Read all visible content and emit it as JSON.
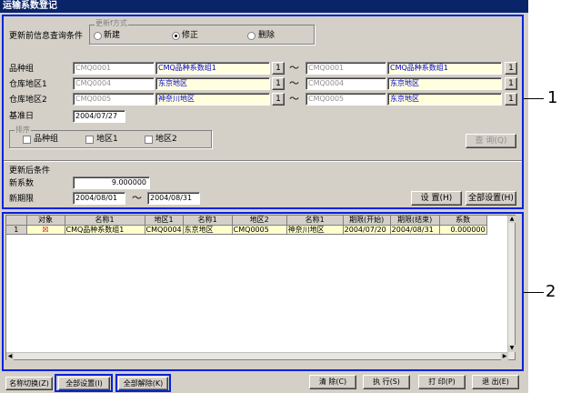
{
  "window": {
    "title": "运输系数登记"
  },
  "search": {
    "label": "更新前信息查询条件",
    "update_method": {
      "caption": "更新f方式",
      "options": [
        {
          "label": "新建",
          "selected": false
        },
        {
          "label": "修正",
          "selected": true
        },
        {
          "label": "删除",
          "selected": false
        }
      ]
    },
    "tilde": "～",
    "rows": [
      {
        "label": "品种组",
        "from_code": "CMQ0001",
        "from_name": "CMQ品种系数组1",
        "to_code": "CMQ0001",
        "to_name": "CMQ品种系数组1",
        "btn": "1"
      },
      {
        "label": "仓库地区1",
        "from_code": "CMQ0004",
        "from_name": "东京地区",
        "to_code": "CMQ0004",
        "to_name": "东京地区",
        "btn": "1"
      },
      {
        "label": "仓库地区2",
        "from_code": "CMQ0005",
        "from_name": "神奈川地区",
        "to_code": "CMQ0005",
        "to_name": "东京地区",
        "btn": "1"
      }
    ],
    "base_date_label": "基准日",
    "base_date": "2004/07/27",
    "sort": {
      "caption": "排序",
      "options": [
        "品种组",
        "地区1",
        "地区2"
      ]
    },
    "query_button": "查 询(Q)"
  },
  "after": {
    "label": "更新后条件",
    "coef_label": "新系数",
    "coef": "9.000000",
    "period_label": "新期限",
    "from": "2004/08/01",
    "tilde": "～",
    "to": "2004/08/31",
    "set_button": "设 置(H)",
    "set_all_button": "全部设置(H)"
  },
  "grid": {
    "columns": [
      "",
      "对象",
      "名称1",
      "地区1",
      "名称1",
      "地区2",
      "名称1",
      "期限(开始)",
      "期限(结束)",
      "系数"
    ],
    "rows": [
      [
        "1",
        "☒",
        "CMQ品种系数组1",
        "CMQ0004",
        "东京地区",
        "CMQ0005",
        "神奈川地区",
        "2004/07/20",
        "2004/08/31",
        "0.000000"
      ]
    ]
  },
  "footer": {
    "rename": "名称切换(Z)",
    "set_all": "全部设置(I)",
    "clear_all": "全部解除(K)",
    "clear": "清 除(C)",
    "execute": "执 行(S)",
    "print": "打 印(P)",
    "exit": "退 出(E)"
  },
  "callouts": {
    "one": "1",
    "two": "2"
  }
}
